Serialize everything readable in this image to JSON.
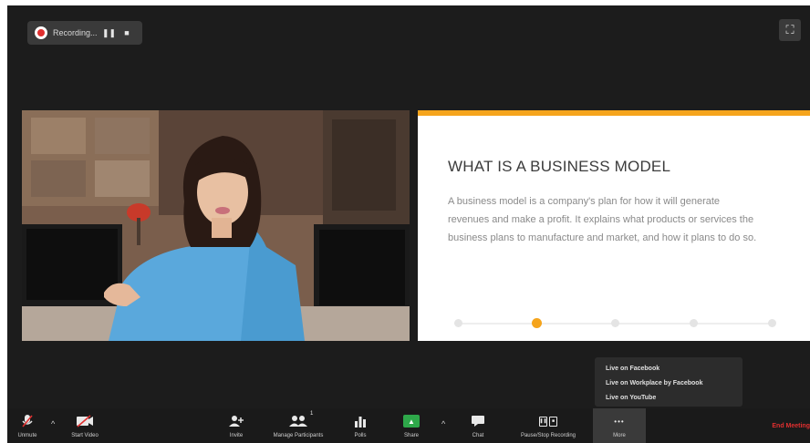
{
  "recording": {
    "label": "Recording...",
    "pause_icon": "pause-icon",
    "stop_icon": "stop-icon",
    "pause_glyph": "❚❚",
    "stop_glyph": "■"
  },
  "fullscreen": {
    "icon": "fullscreen-icon",
    "glyph": "⛶"
  },
  "slide": {
    "title": "WHAT IS A BUSINESS MODEL",
    "body": "A business model is a company's plan for how it will generate revenues and make a profit. It explains what products or services the business plans to manufacture and market, and how it plans to do so.",
    "timeline_steps": 5,
    "active_step": 2,
    "accent": "#f5a41c"
  },
  "more_menu": {
    "items": [
      "Live on Facebook",
      "Live on Workplace by Facebook",
      "Live on YouTube"
    ]
  },
  "toolbar": {
    "unmute": {
      "label": "Unmute",
      "icon": "mic-muted-icon",
      "glyph": "🎤"
    },
    "start_video": {
      "label": "Start Video",
      "icon": "video-off-icon",
      "glyph": "▮"
    },
    "invite": {
      "label": "Invite",
      "icon": "add-person-icon",
      "glyph": "👤"
    },
    "manage_participants": {
      "label": "Manage Participants",
      "icon": "participants-icon",
      "glyph": "👥",
      "count": "1"
    },
    "polls": {
      "label": "Polls",
      "icon": "polls-icon",
      "glyph": "▂▅▇"
    },
    "share": {
      "label": "Share",
      "icon": "share-screen-icon",
      "glyph": "▲"
    },
    "chat": {
      "label": "Chat",
      "icon": "chat-icon",
      "glyph": "▬"
    },
    "pause_stop_recording": {
      "label": "Pause/Stop Recording",
      "icon": "recording-controls-icon",
      "glyph_left": "❚❚",
      "glyph_right": "■"
    },
    "more": {
      "label": "More",
      "icon": "more-icon",
      "glyph": "•••"
    },
    "end_meeting": {
      "label": "End Meeting",
      "color": "#e02f2f"
    },
    "caret_glyph": "^"
  }
}
